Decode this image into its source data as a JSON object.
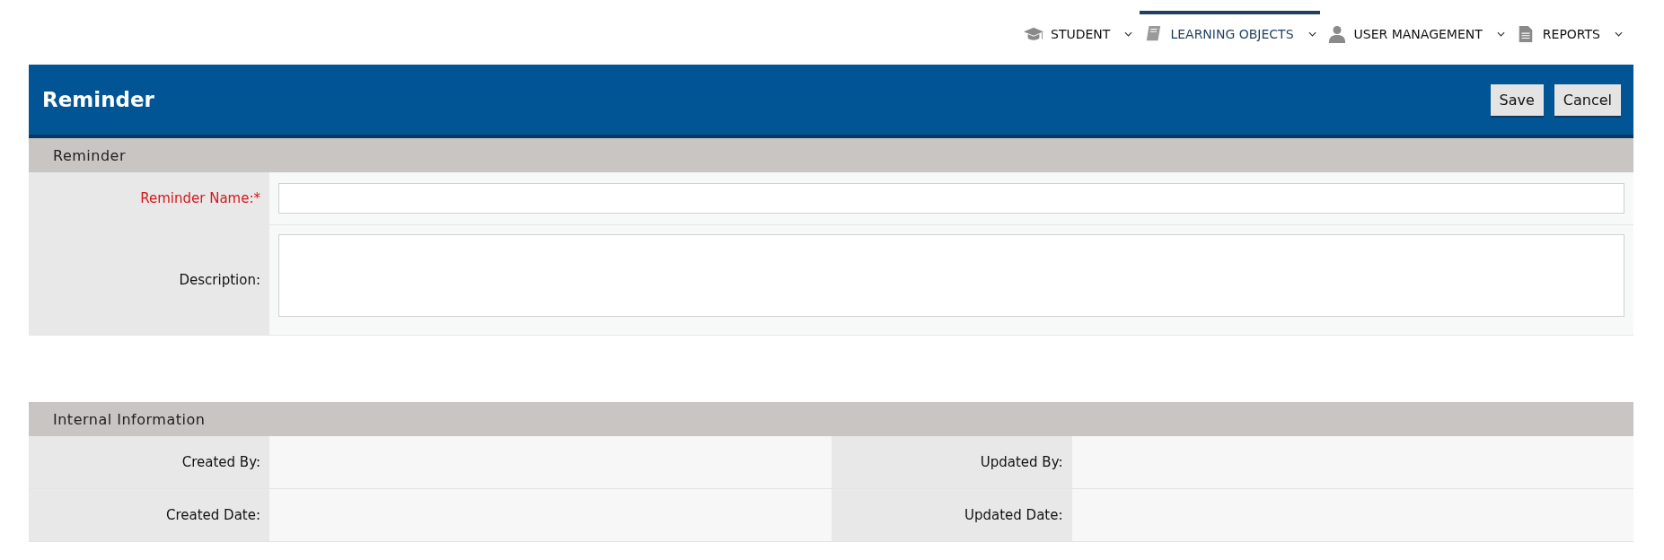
{
  "nav": [
    {
      "label": "STUDENT",
      "kind": "cap",
      "selected": false
    },
    {
      "label": "LEARNING OBJECTS",
      "kind": "book",
      "selected": true
    },
    {
      "label": "USER MANAGEMENT",
      "kind": "user",
      "selected": false
    },
    {
      "label": "REPORTS",
      "kind": "doc",
      "selected": false
    }
  ],
  "header": {
    "title": "Reminder",
    "buttons": [
      "Save",
      "Cancel"
    ]
  },
  "sections": [
    {
      "title": "Reminder",
      "kind": "form",
      "fields": [
        {
          "label": "Reminder Name:*",
          "required": true,
          "kind": "input"
        },
        {
          "label": "Description:",
          "required": false,
          "kind": "textarea"
        }
      ]
    },
    {
      "title": "Internal Information",
      "kind": "info",
      "rows": [
        [
          {
            "label": "Created By:"
          },
          {
            "label": "Updated By:"
          }
        ],
        [
          {
            "label": "Created Date:"
          },
          {
            "label": "Updated Date:"
          }
        ]
      ]
    }
  ]
}
